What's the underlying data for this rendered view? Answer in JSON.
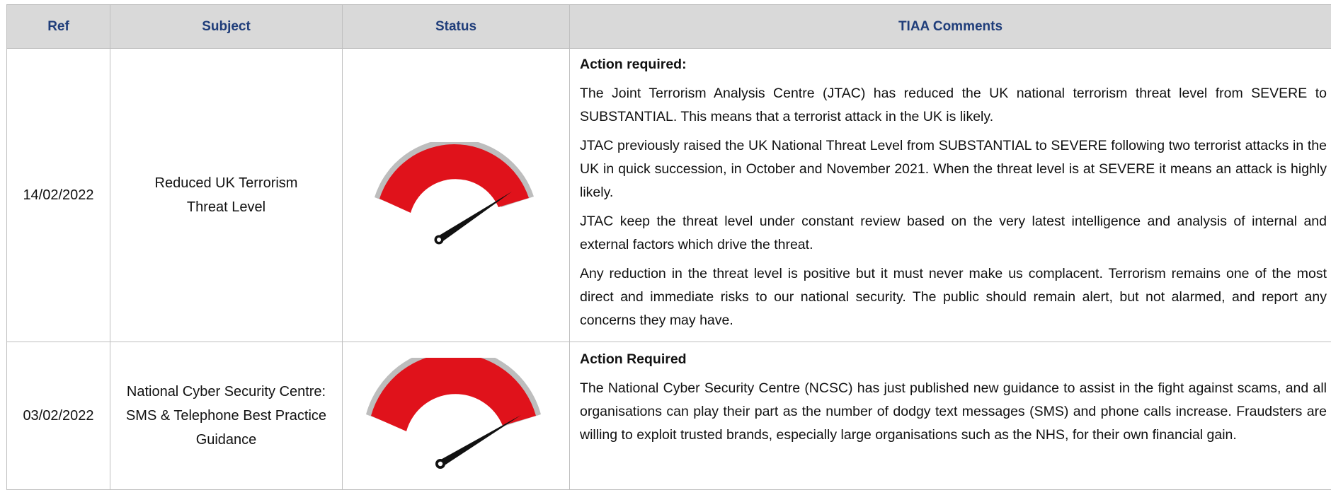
{
  "header": {
    "ref": "Ref",
    "subject": "Subject",
    "status": "Status",
    "comments": "TIAA Comments"
  },
  "rows": [
    {
      "ref": "14/02/2022",
      "subject_lines": [
        "Reduced UK Terrorism",
        "Threat Level"
      ],
      "status_icon": "gauge-high-icon",
      "comment_heading": "Action required:",
      "paragraphs": [
        "The Joint Terrorism Analysis Centre (JTAC) has reduced the UK national terrorism threat level from SEVERE to SUBSTANTIAL. This means that a terrorist attack in the UK is likely.",
        "JTAC previously raised the UK National Threat Level from SUBSTANTIAL to SEVERE following two terrorist attacks in the UK in quick succession, in October and November 2021. When the threat level is at SEVERE it means an attack is highly likely.",
        "JTAC keep the threat level under constant review based on the very latest intelligence and analysis of internal and external factors which drive the threat.",
        "Any reduction in the threat level is positive but it must never make us complacent. Terrorism remains one of the most direct and immediate risks to our national security. The public should remain alert, but not alarmed, and report any concerns they may have."
      ]
    },
    {
      "ref": "03/02/2022",
      "subject_lines": [
        "National Cyber Security Centre:",
        "SMS & Telephone Best Practice Guidance"
      ],
      "status_icon": "gauge-high-icon",
      "comment_heading": "Action Required",
      "paragraphs": [
        "The National Cyber Security Centre (NCSC) has just published new guidance to assist in the fight against scams, and all organisations can play their part as the number of dodgy text messages (SMS) and phone calls increase. Fraudsters are willing to exploit trusted brands, especially large organisations such as the NHS, for their own financial gain."
      ]
    }
  ],
  "colors": {
    "header_text": "#1f3d7a",
    "header_bg": "#d9d9d9",
    "gauge_red": "#e0121b",
    "gauge_rim": "#bdbdbd",
    "needle": "#111111"
  }
}
